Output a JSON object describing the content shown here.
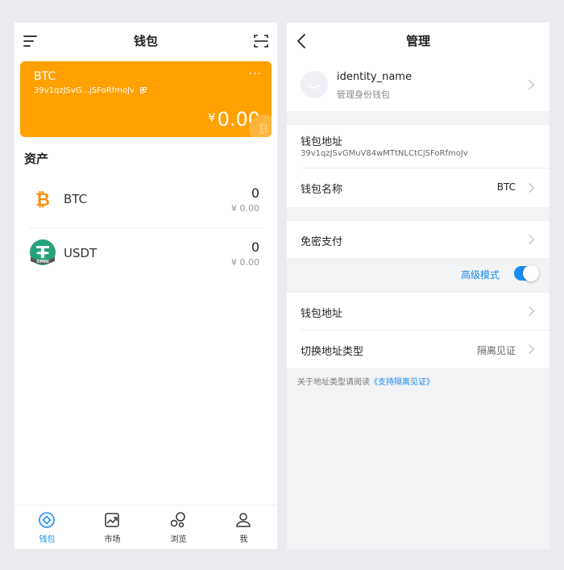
{
  "wallet": {
    "title": "钱包",
    "card": {
      "name": "BTC",
      "address": "39v1qzJSvG...jSFoRfmoJv",
      "more": "···",
      "currency": "¥",
      "balance": "0.00",
      "watermark": "₿"
    },
    "assets_title": "资产",
    "assets": [
      {
        "name": "BTC",
        "amount": "0",
        "fiat": "¥ 0.00"
      },
      {
        "name": "USDT",
        "amount": "0",
        "fiat": "¥ 0.00"
      }
    ],
    "omni_label": "OMNI",
    "tabs": [
      {
        "label": "钱包",
        "icon": "wallet-icon",
        "active": true
      },
      {
        "label": "市场",
        "icon": "market-icon"
      },
      {
        "label": "浏览",
        "icon": "browse-icon"
      },
      {
        "label": "我",
        "icon": "profile-icon"
      }
    ]
  },
  "manage": {
    "title": "管理",
    "identity_name": "identity_name",
    "identity_sub": "管理身份钱包",
    "address_label": "钱包地址",
    "address_full": "39v1qzJSvGMuV84wMTtNLCtCjSFoRfmoJv",
    "wallet_name_label": "钱包名称",
    "wallet_name_value": "BTC",
    "no_password_pay": "免密支付",
    "advanced_mode": "高级模式",
    "advanced_on": true,
    "address_row": "钱包地址",
    "switch_type_label": "切换地址类型",
    "switch_type_value": "隔离见证",
    "footer_prefix": "关于地址类型请阅读",
    "footer_link": "《支持隔离见证》"
  },
  "colors": {
    "accent": "#1a8bf0",
    "card": "#ffa100",
    "btc": "#f7931a",
    "usdt": "#26a17b"
  }
}
